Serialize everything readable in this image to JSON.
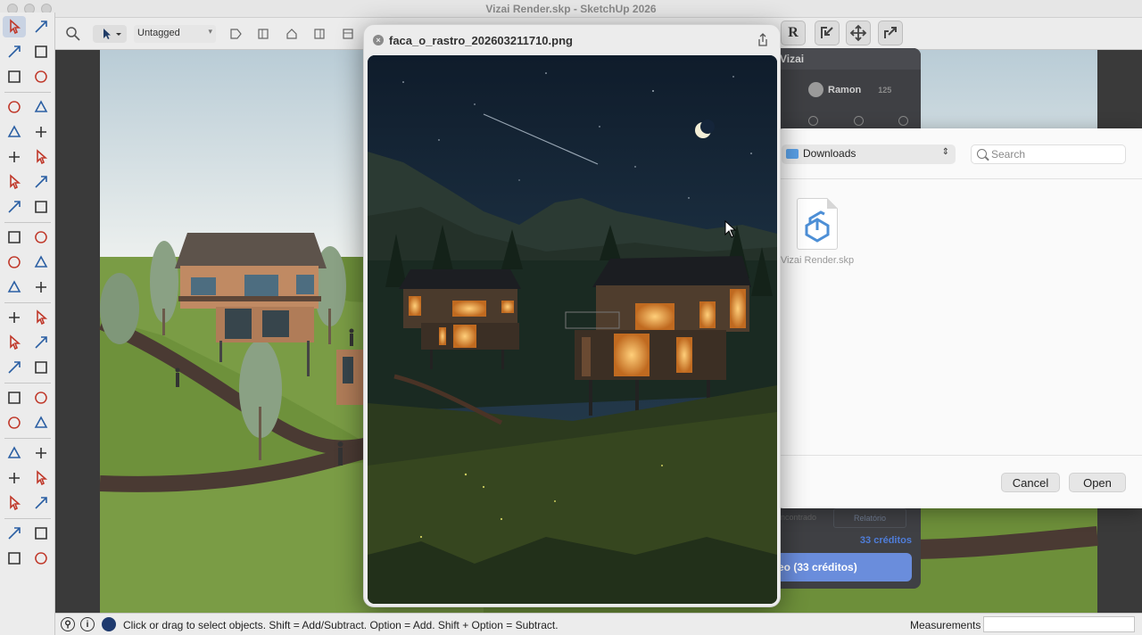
{
  "window": {
    "title": "Vizai Render.skp - SketchUp 2026"
  },
  "toolbar": {
    "tag_value": "Untagged",
    "right_icons": [
      "render-r-icon",
      "import-icon",
      "zoom-extents-icon",
      "export-icon"
    ]
  },
  "tools": {
    "items": [
      "select",
      "lasso",
      "paint-bucket",
      "eraser",
      "components",
      "tape",
      "pencil",
      "freehand",
      "rectangle",
      "rotated-rectangle",
      "circle",
      "polygon",
      "arc",
      "pie",
      "two-point-arc",
      "three-point-arc",
      "move",
      "push-pull",
      "rotate",
      "follow-me",
      "scale",
      "offset",
      "dimension",
      "text",
      "tape-measure",
      "protractor",
      "axes",
      "3d-text",
      "orbit",
      "pan",
      "section-plane",
      "section-fill",
      "zoom",
      "zoom-window",
      "zoom-extents",
      "previous",
      "position-camera",
      "walk",
      "look-around",
      "pinned",
      "sandbox",
      "styles"
    ]
  },
  "quicklook": {
    "filename": "faca_o_rastro_202603211710.png"
  },
  "vizai": {
    "header": "Vizai",
    "user_name": "Ramon",
    "credit_badge": "125",
    "tab_left": "ncontrado",
    "tab_right": "Relatório",
    "credits_text": "33 créditos",
    "render_button": "eo (33 créditos)"
  },
  "open_dialog": {
    "location": "Downloads",
    "search_placeholder": "Search",
    "file_name": "Vizai Render.skp",
    "cancel_label": "Cancel",
    "open_label": "Open"
  },
  "statusbar": {
    "text": "Click or drag to select objects. Shift = Add/Subtract. Option = Add. Shift + Option = Subtract.",
    "measurements_label": "Measurements"
  },
  "colors": {
    "accent_blue": "#6a8ddc",
    "credits_blue": "#4f7dd9",
    "grass": "#6d8f3a",
    "path": "#4a3a33",
    "night_sky": "#0e1a28"
  }
}
